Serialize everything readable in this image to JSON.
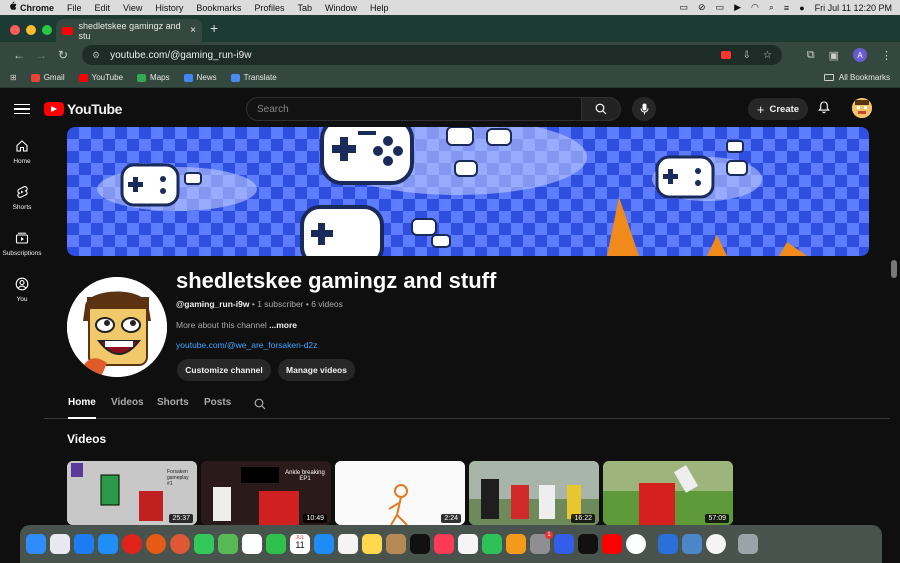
{
  "menubar": {
    "apple": "",
    "items": [
      "Chrome",
      "File",
      "Edit",
      "View",
      "History",
      "Bookmarks",
      "Profiles",
      "Tab",
      "Window",
      "Help"
    ],
    "datetime": "Fri Jul 11  12:20 PM"
  },
  "browser": {
    "tab_title": "shedletskee gamingz and stu",
    "url": "youtube.com/@gaming_run-i9w",
    "profile_initial": "A",
    "bookmarks": [
      "Gmail",
      "YouTube",
      "Maps",
      "News",
      "Translate"
    ],
    "all_bookmarks": "All Bookmarks"
  },
  "youtube": {
    "logo_text": "YouTube",
    "search_placeholder": "Search",
    "create_label": "Create",
    "sidebar": [
      {
        "label": "Home",
        "icon": "home-icon"
      },
      {
        "label": "Shorts",
        "icon": "shorts-icon"
      },
      {
        "label": "Subscriptions",
        "icon": "subscriptions-icon"
      },
      {
        "label": "You",
        "icon": "you-icon"
      }
    ]
  },
  "channel": {
    "name": "shedletskee gamingz and stuff",
    "handle": "@gaming_run-i9w",
    "subscribers": "1 subscriber",
    "videos_count": "6 videos",
    "separator": "•",
    "description": "More about this channel",
    "more": "...more",
    "link": "youtube.com/@we_are_forsaken-d2z",
    "buttons": [
      "Customize channel",
      "Manage videos"
    ],
    "tabs": [
      "Home",
      "Videos",
      "Shorts",
      "Posts"
    ],
    "section_title": "Videos",
    "videos": [
      {
        "overlay": "Forsaken gameplay #1",
        "duration": "25:37"
      },
      {
        "overlay": "Ankle breaking EP1",
        "duration": "10:49"
      },
      {
        "overlay": "",
        "duration": "2:24"
      },
      {
        "overlay": "",
        "duration": "16:22"
      },
      {
        "overlay": "",
        "duration": "57:09"
      }
    ]
  },
  "dock": {
    "calendar_month": "JUL",
    "calendar_day": "11",
    "settings_badge": "1"
  },
  "colors": {
    "accent_red": "#ff0000",
    "link_blue": "#3ea6ff",
    "banner_blue": "#2f4fe0"
  }
}
